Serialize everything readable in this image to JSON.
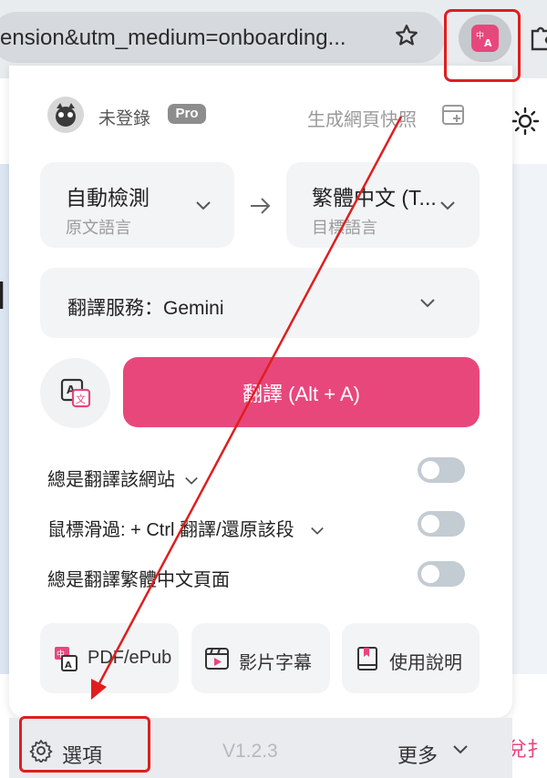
{
  "browser": {
    "url_text": "ension&utm_medium=onboarding...",
    "extension_icon": "translate-extension-icon",
    "star_icon": "star-icon",
    "puzzle_icon": "puzzle-icon"
  },
  "background_page": {
    "glyph": "I",
    "right_text": "兌扌"
  },
  "header": {
    "login_label": "未登錄",
    "pro_badge": "Pro",
    "snapshot_label": "生成網頁快照"
  },
  "languages": {
    "source": {
      "value": "自動檢測",
      "label": "原文語言"
    },
    "target": {
      "value": "繁體中文 (T...",
      "label": "目標語言"
    }
  },
  "service": {
    "label": "翻譯服務：Gemini"
  },
  "translate_button": {
    "label": "翻譯 (Alt + A)"
  },
  "options": [
    {
      "label": "總是翻譯該網站",
      "has_dropdown": true,
      "enabled": false
    },
    {
      "label": "鼠標滑過:  + Ctrl 翻譯/還原該段",
      "has_dropdown": true,
      "enabled": false
    },
    {
      "label": "總是翻譯繁體中文頁面",
      "has_dropdown": false,
      "enabled": false
    }
  ],
  "tools": [
    {
      "label": "PDF/ePub",
      "icon": "pdf-translate-icon"
    },
    {
      "label": "影片字幕",
      "icon": "video-subtitle-icon"
    },
    {
      "label": "使用說明",
      "icon": "book-icon"
    }
  ],
  "footer": {
    "options_label": "選項",
    "version": "V1.2.3",
    "more_label": "更多"
  },
  "colors": {
    "accent": "#e8477c",
    "annotation": "#e01e1e"
  }
}
